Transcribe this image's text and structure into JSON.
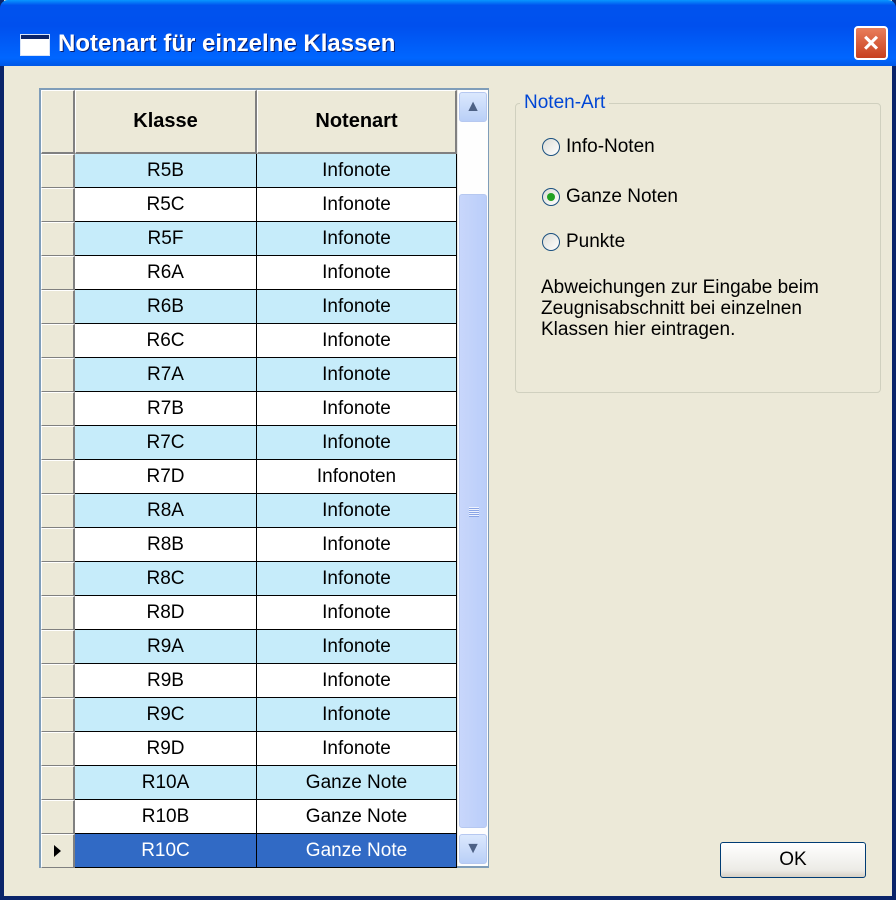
{
  "window": {
    "title": "Notenart für einzelne Klassen",
    "close_icon": "close-icon"
  },
  "grid": {
    "columns": [
      "Klasse",
      "Notenart"
    ],
    "rows": [
      {
        "klasse": "R5B",
        "notenart": "Infonote"
      },
      {
        "klasse": "R5C",
        "notenart": "Infonote"
      },
      {
        "klasse": "R5F",
        "notenart": "Infonote"
      },
      {
        "klasse": "R6A",
        "notenart": "Infonote"
      },
      {
        "klasse": "R6B",
        "notenart": "Infonote"
      },
      {
        "klasse": "R6C",
        "notenart": "Infonote"
      },
      {
        "klasse": "R7A",
        "notenart": "Infonote"
      },
      {
        "klasse": "R7B",
        "notenart": "Infonote"
      },
      {
        "klasse": "R7C",
        "notenart": "Infonote"
      },
      {
        "klasse": "R7D",
        "notenart": "Infonoten"
      },
      {
        "klasse": "R8A",
        "notenart": "Infonote"
      },
      {
        "klasse": "R8B",
        "notenart": "Infonote"
      },
      {
        "klasse": "R8C",
        "notenart": "Infonote"
      },
      {
        "klasse": "R8D",
        "notenart": "Infonote"
      },
      {
        "klasse": "R9A",
        "notenart": "Infonote"
      },
      {
        "klasse": "R9B",
        "notenart": "Infonote"
      },
      {
        "klasse": "R9C",
        "notenart": "Infonote"
      },
      {
        "klasse": "R9D",
        "notenart": "Infonote"
      },
      {
        "klasse": "R10A",
        "notenart": "Ganze Note"
      },
      {
        "klasse": "R10B",
        "notenart": "Ganze Note"
      },
      {
        "klasse": "R10C",
        "notenart": "Ganze Note"
      }
    ],
    "selected_row": "R10C",
    "alt_row_color": "#c6ecfa",
    "selected_color": "#316ac5"
  },
  "groupbox": {
    "legend": "Noten-Art",
    "options": [
      {
        "label": "Info-Noten",
        "checked": false
      },
      {
        "label": "Ganze Noten",
        "checked": true
      },
      {
        "label": "Punkte",
        "checked": false
      }
    ],
    "hint": "Abweichungen zur Eingabe beim Zeugnisabschnitt bei einzelnen Klassen hier eintragen."
  },
  "ok_label": "OK"
}
